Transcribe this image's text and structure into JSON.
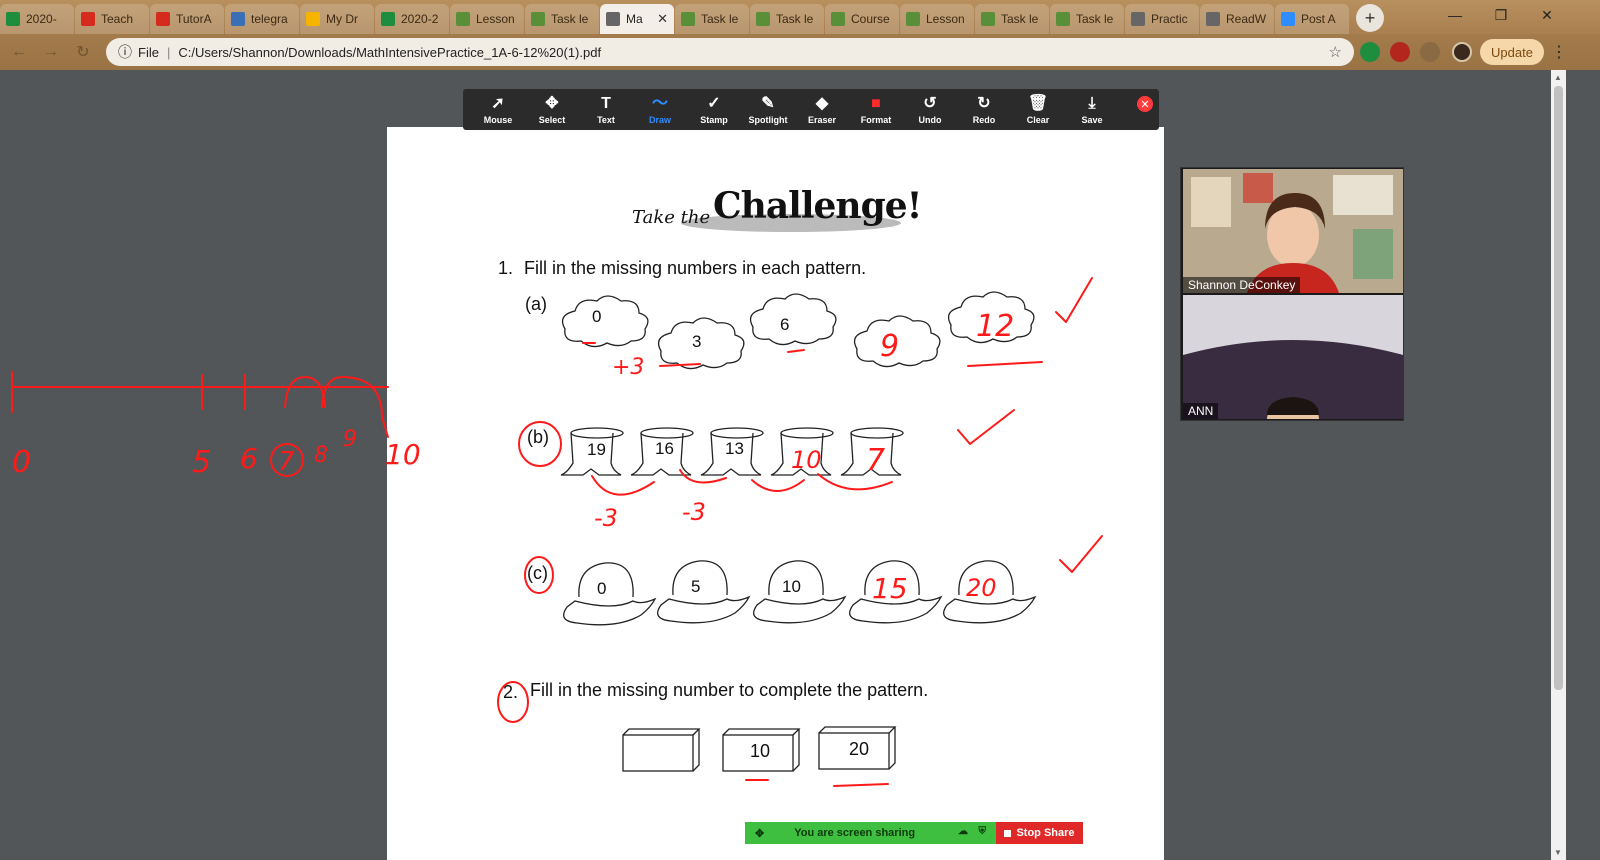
{
  "browser": {
    "tabs": [
      {
        "label": "2020-",
        "icon": "google-sheets-icon",
        "color": "#1e8e3e"
      },
      {
        "label": "Teach",
        "icon": "info-red-icon",
        "color": "#d42b1e"
      },
      {
        "label": "TutorA",
        "icon": "info-red-icon",
        "color": "#d42b1e"
      },
      {
        "label": "telegra",
        "icon": "telegraph-icon",
        "color": "#3a6fb5"
      },
      {
        "label": "My Dr",
        "icon": "google-drive-icon",
        "color": "#f4b400"
      },
      {
        "label": "2020-2",
        "icon": "google-sheets-icon",
        "color": "#1e8e3e"
      },
      {
        "label": "Lesson",
        "icon": "page-icon",
        "color": "#5a8f3a"
      },
      {
        "label": "Task le",
        "icon": "page-icon",
        "color": "#5a8f3a"
      },
      {
        "label": "Ma",
        "icon": "globe-icon",
        "color": "#666666",
        "active": true
      },
      {
        "label": "Task le",
        "icon": "page-icon",
        "color": "#5a8f3a"
      },
      {
        "label": "Task le",
        "icon": "page-icon",
        "color": "#5a8f3a"
      },
      {
        "label": "Course",
        "icon": "page-icon",
        "color": "#5a8f3a"
      },
      {
        "label": "Lesson",
        "icon": "page-icon",
        "color": "#5a8f3a"
      },
      {
        "label": "Task le",
        "icon": "page-icon",
        "color": "#5a8f3a"
      },
      {
        "label": "Task le",
        "icon": "page-icon",
        "color": "#5a8f3a"
      },
      {
        "label": "Practic",
        "icon": "globe-icon",
        "color": "#666666"
      },
      {
        "label": "ReadW",
        "icon": "globe-icon",
        "color": "#666666"
      },
      {
        "label": "Post A",
        "icon": "zoom-icon",
        "color": "#2d8cff"
      }
    ],
    "new_tab": "+",
    "window_controls": {
      "minimize": "—",
      "restore": "❐",
      "close": "✕"
    },
    "address": {
      "scheme_label": "File",
      "url": "C:/Users/Shannon/Downloads/MathIntensivePractice_1A-6-12%20(1).pdf"
    },
    "update_label": "Update"
  },
  "toolbar": {
    "tools": [
      {
        "label": "Mouse",
        "glyph": "➚"
      },
      {
        "label": "Select",
        "glyph": "✥"
      },
      {
        "label": "Text",
        "glyph": "T"
      },
      {
        "label": "Draw",
        "glyph": "〜",
        "active": true
      },
      {
        "label": "Stamp",
        "glyph": "✓"
      },
      {
        "label": "Spotlight",
        "glyph": "✎"
      },
      {
        "label": "Eraser",
        "glyph": "◆"
      },
      {
        "label": "Format",
        "glyph": "■"
      },
      {
        "label": "Undo",
        "glyph": "↺"
      },
      {
        "label": "Redo",
        "glyph": "↻"
      },
      {
        "label": "Clear",
        "glyph": "🗑"
      },
      {
        "label": "Save",
        "glyph": "⤓"
      }
    ],
    "format_color": "#ff2a2a"
  },
  "worksheet": {
    "heading_small": "Take the",
    "heading_big": "Challenge!",
    "q1_num": "1.",
    "q1_text": "Fill in the missing numbers in each pattern.",
    "part_a": "(a)",
    "part_b": "(b)",
    "part_c": "(c)",
    "a_values": [
      "0",
      "3",
      "6"
    ],
    "b_values": [
      "19",
      "16",
      "13"
    ],
    "c_values": [
      "0",
      "5",
      "10"
    ],
    "q2_num": "2.",
    "q2_text": "Fill in the missing number to complete the pattern.",
    "q2_values": [
      "10",
      "20"
    ]
  },
  "annotations": {
    "ink_color": "#ff1a1a",
    "a_written": [
      "9",
      "12"
    ],
    "a_rule": "+3",
    "b_written": [
      "10",
      "7"
    ],
    "b_rule": [
      "-3",
      "-3"
    ],
    "c_written": [
      "15",
      "20"
    ],
    "numberline_labels": [
      "0",
      "5",
      "6",
      "7",
      "8",
      "9",
      "10"
    ]
  },
  "video": {
    "participants": [
      {
        "name": "Shannon DeConkey"
      },
      {
        "name": "ANN"
      }
    ]
  },
  "share_bar": {
    "status": "You are screen sharing",
    "stop_label": "Stop Share",
    "status_color": "#3fbf3f",
    "stop_color": "#e02828"
  }
}
